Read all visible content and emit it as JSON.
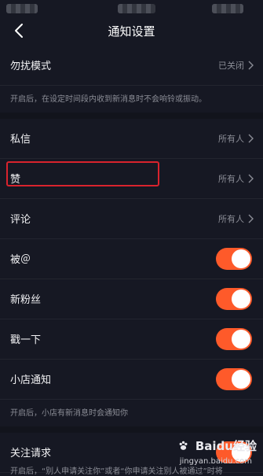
{
  "nav": {
    "title": "通知设置"
  },
  "dnd": {
    "label": "勿扰模式",
    "value": "已关闭",
    "hint": "开启后，在设定时间段内收到新消息时不会响铃或振动。"
  },
  "privacy_rows": [
    {
      "label": "私信",
      "value": "所有人"
    },
    {
      "label": "赞",
      "value": "所有人"
    },
    {
      "label": "评论",
      "value": "所有人"
    }
  ],
  "toggle_rows": [
    {
      "label": "被＠",
      "on": true
    },
    {
      "label": "新粉丝",
      "on": true
    },
    {
      "label": "戳一下",
      "on": true
    },
    {
      "label": "小店通知",
      "on": true
    }
  ],
  "shop_hint": "开启后，小店有新消息时会通知你",
  "follow": {
    "label": "关注请求",
    "on": true,
    "hint": "开启后，“别人申请关注你”或者“你申请关注别人被通过”时将"
  },
  "watermark": {
    "brand": "Baidu经验",
    "url": "jingyan.baidu.com"
  },
  "colors": {
    "background": "#161823",
    "accent": "#fe5a2a",
    "highlight": "#d9232d"
  }
}
